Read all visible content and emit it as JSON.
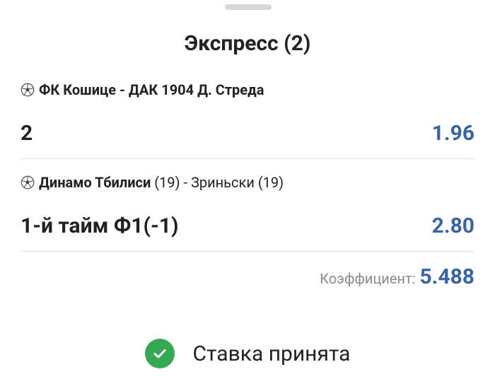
{
  "sheet": {
    "title": "Экспресс (2)"
  },
  "bets": [
    {
      "match": "ФК Кошице - ДАК 1904 Д. Стреда",
      "selection": "2",
      "odds": "1.96"
    },
    {
      "match_prefix": "Динамо Тбилиси",
      "match_rest": " (19) - Зриньски (19)",
      "selection": "1-й тайм Ф1(-1)",
      "odds": "2.80"
    }
  ],
  "summary": {
    "coefficient_label": "Коэффициент:",
    "coefficient_value": "5.488"
  },
  "status": {
    "text": "Ставка принята",
    "icon": "check-circle-icon",
    "color": "#35a852"
  },
  "colors": {
    "accent": "#3a63a6",
    "muted": "#8a8a8a"
  }
}
